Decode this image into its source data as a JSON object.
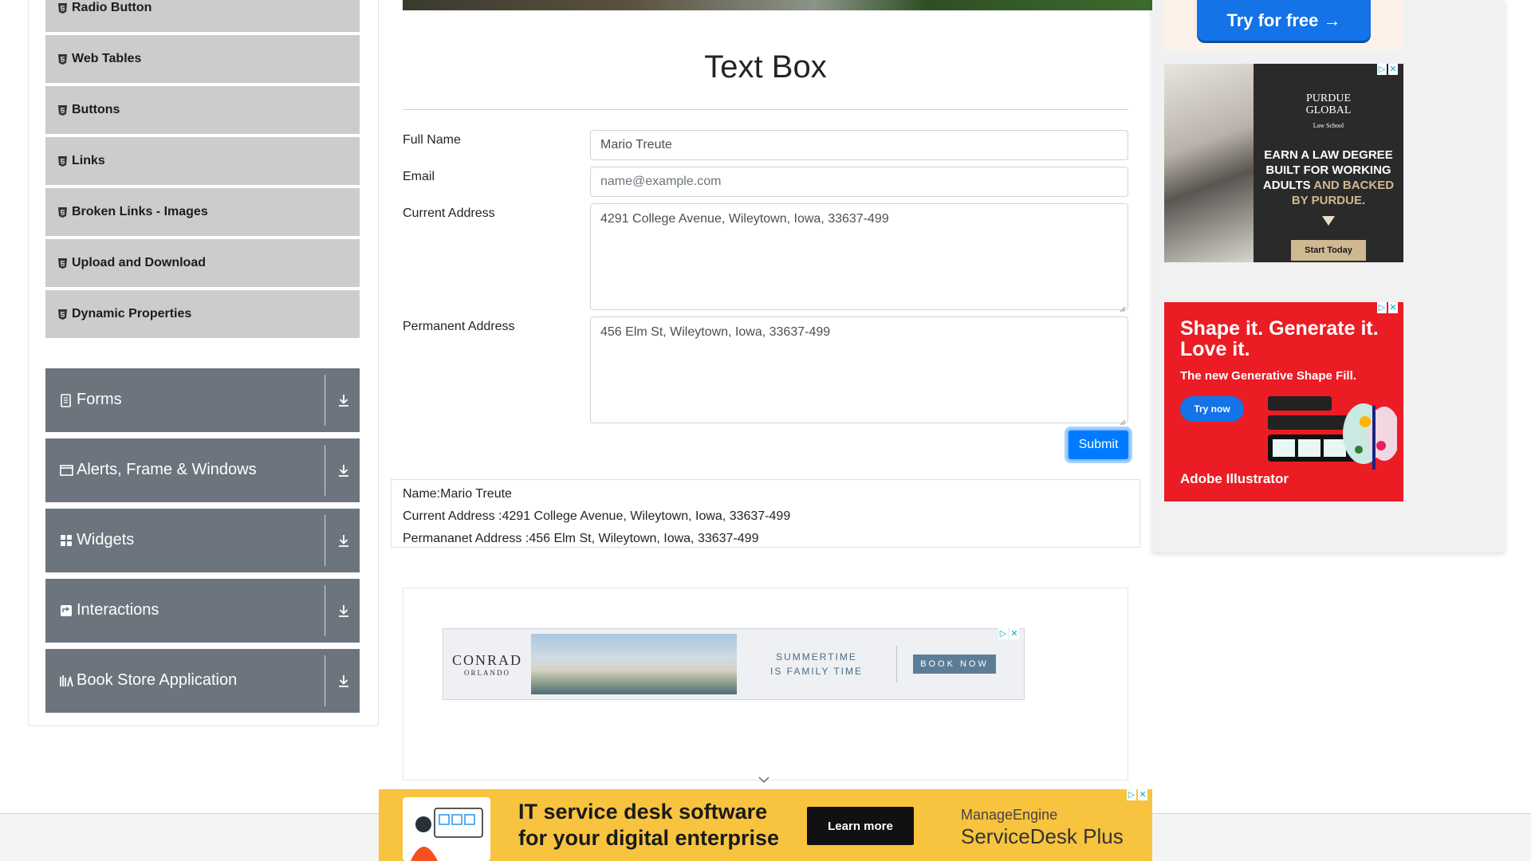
{
  "sidebar": {
    "submenu": [
      {
        "label": "Radio Button"
      },
      {
        "label": "Web Tables"
      },
      {
        "label": "Buttons"
      },
      {
        "label": "Links"
      },
      {
        "label": "Broken Links - Images"
      },
      {
        "label": "Upload and Download"
      },
      {
        "label": "Dynamic Properties"
      }
    ],
    "groups": [
      {
        "label": "Forms",
        "icon": "document-icon"
      },
      {
        "label": "Alerts, Frame & Windows",
        "icon": "window-icon"
      },
      {
        "label": "Widgets",
        "icon": "grid-icon"
      },
      {
        "label": "Interactions",
        "icon": "interaction-icon"
      },
      {
        "label": "Book Store Application",
        "icon": "books-icon"
      }
    ]
  },
  "main": {
    "title": "Text Box",
    "form": {
      "full_name_label": "Full Name",
      "full_name_value": "Mario Treute",
      "email_label": "Email",
      "email_placeholder": "name@example.com",
      "current_address_label": "Current Address",
      "current_address_value": "4291 College Avenue, Wileytown, Iowa, 33637-499",
      "permanent_address_label": "Permanent Address",
      "permanent_address_value": "456 Elm St, Wileytown, Iowa, 33637-499",
      "submit_label": "Submit"
    },
    "output": {
      "name": "Name:Mario Treute",
      "current_address": "Current Address :4291 College Avenue, Wileytown, Iowa, 33637-499",
      "permanent_address": "Permananet Address :456 Elm St, Wileytown, Iowa, 33637-499"
    }
  },
  "ads": {
    "top_right_button": "Try for free →",
    "purdue": {
      "brand_line1": "PURDUE",
      "brand_line2": "GLOBAL",
      "brand_line3": "Law School",
      "copy_white1": "EARN A LAW DEGREE",
      "copy_white2": "BUILT FOR WORKING",
      "copy_white3": "ADULTS",
      "copy_gold1": "AND BACKED",
      "copy_gold2": "BY PURDUE.",
      "cta": "Start Today"
    },
    "adobe": {
      "headline": "Shape it. Generate it. Love it.",
      "subline": "The new Generative Shape Fill.",
      "cta": "Try now",
      "brand": "Adobe Illustrator"
    },
    "conrad": {
      "logo_line1": "CONRAD",
      "logo_line2": "ORLANDO",
      "tagline1": "SUMMERTIME",
      "tagline2": "IS FAMILY TIME",
      "cta": "BOOK NOW"
    },
    "bottom": {
      "headline1": "IT service desk software",
      "headline2": "for your digital enterprise",
      "cta": "Learn more",
      "brand1": "ManageEngine",
      "brand2": "ServiceDesk Plus"
    }
  },
  "colors": {
    "submenu_bg": "#cccccc",
    "group_bg": "#6c757d",
    "primary": "#007bff"
  }
}
